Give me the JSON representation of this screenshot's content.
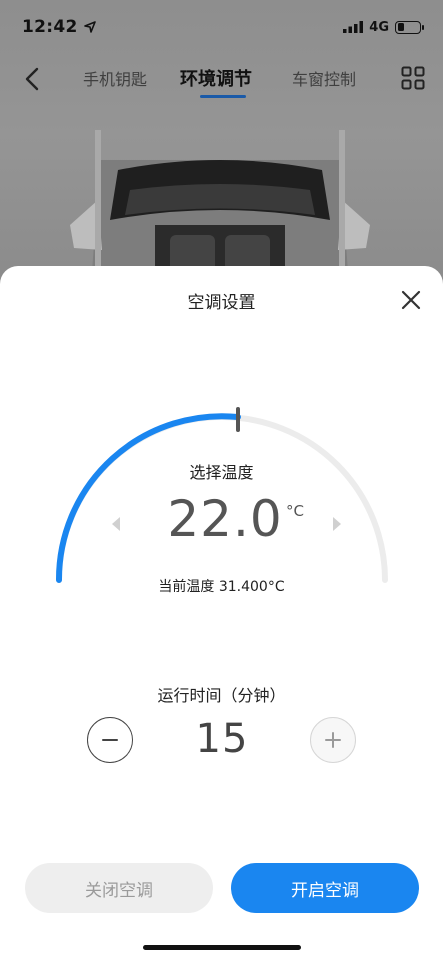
{
  "status_bar": {
    "time": "12:42",
    "network": "4G",
    "icons": [
      "location-arrow-icon",
      "signal-icon",
      "battery-icon"
    ]
  },
  "nav": {
    "tabs": [
      {
        "label": "手机钥匙",
        "active": false
      },
      {
        "label": "环境调节",
        "active": true
      },
      {
        "label": "车窗控制",
        "active": false
      }
    ],
    "icons": [
      "back-chevron-icon",
      "grid-menu-icon"
    ]
  },
  "sheet": {
    "title": "空调设置",
    "dial": {
      "label": "选择温度",
      "value": "22.0",
      "unit": "°C",
      "arc_fill_fraction": 0.5
    },
    "current_temp": "当前温度 31.400°C",
    "runtime": {
      "label": "运行时间（分钟）",
      "value": "15"
    },
    "buttons": {
      "off": "关闭空调",
      "on": "开启空调"
    }
  },
  "colors": {
    "accent": "#1a86f0",
    "arc_track": "#ececec",
    "tab_indicator": "#1a5aa8"
  }
}
